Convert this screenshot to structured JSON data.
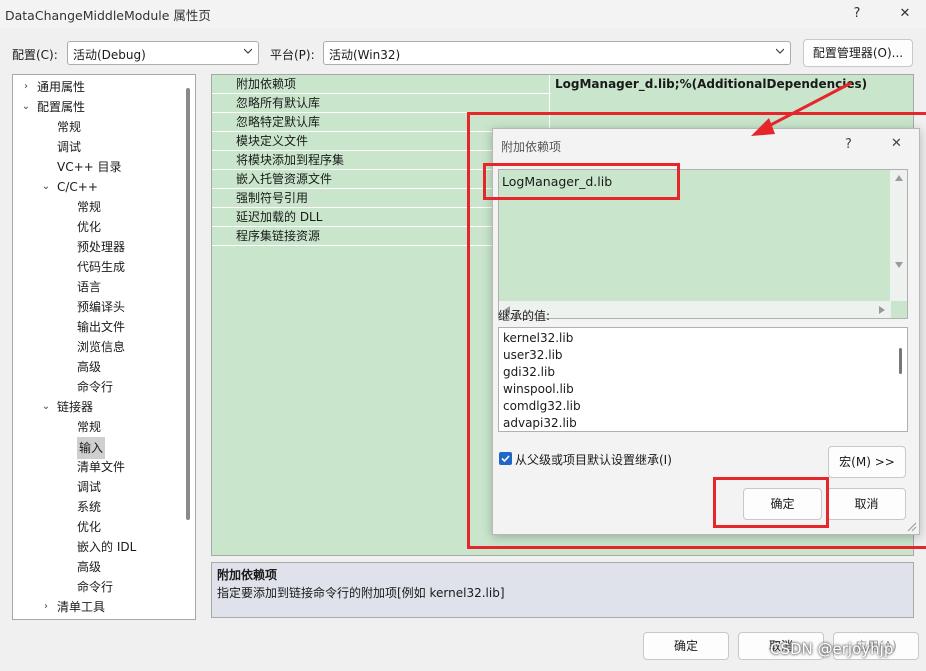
{
  "window": {
    "title": "DataChangeMiddleModule 属性页",
    "help_label": "?",
    "close_label": "✕"
  },
  "toolbar": {
    "config_label": "配置(C):",
    "config_value": "活动(Debug)",
    "platform_label": "平台(P):",
    "platform_value": "活动(Win32)",
    "config_manager_label": "配置管理器(O)..."
  },
  "tree": {
    "items": [
      {
        "label": "通用属性",
        "arrow": "›"
      },
      {
        "label": "配置属性",
        "arrow": "⌄"
      },
      {
        "label": "常规"
      },
      {
        "label": "调试"
      },
      {
        "label": "VC++ 目录"
      },
      {
        "label": "C/C++",
        "arrow": "⌄"
      },
      {
        "label": "常规"
      },
      {
        "label": "优化"
      },
      {
        "label": "预处理器"
      },
      {
        "label": "代码生成"
      },
      {
        "label": "语言"
      },
      {
        "label": "预编译头"
      },
      {
        "label": "输出文件"
      },
      {
        "label": "浏览信息"
      },
      {
        "label": "高级"
      },
      {
        "label": "命令行"
      },
      {
        "label": "链接器",
        "arrow": "⌄"
      },
      {
        "label": "常规"
      },
      {
        "label": "输入",
        "selected": true
      },
      {
        "label": "清单文件"
      },
      {
        "label": "调试"
      },
      {
        "label": "系统"
      },
      {
        "label": "优化"
      },
      {
        "label": "嵌入的 IDL"
      },
      {
        "label": "高级"
      },
      {
        "label": "命令行"
      },
      {
        "label": "清单工具",
        "arrow": "›"
      }
    ]
  },
  "grid": {
    "rows": [
      {
        "name": "附加依赖项",
        "value": "LogManager_d.lib;%(AdditionalDependencies)"
      },
      {
        "name": "忽略所有默认库",
        "value": ""
      },
      {
        "name": "忽略特定默认库",
        "value": ""
      },
      {
        "name": "模块定义文件",
        "value": ""
      },
      {
        "name": "将模块添加到程序集",
        "value": ""
      },
      {
        "name": "嵌入托管资源文件",
        "value": ""
      },
      {
        "name": "强制符号引用",
        "value": ""
      },
      {
        "name": "延迟加载的 DLL",
        "value": ""
      },
      {
        "name": "程序集链接资源",
        "value": ""
      }
    ]
  },
  "description": {
    "title": "附加依赖项",
    "text": "指定要添加到链接命令行的附加项[例如 kernel32.lib]"
  },
  "dialog": {
    "title": "附加依赖项",
    "help_label": "?",
    "close_label": "✕",
    "editor_text": "LogManager_d.lib",
    "inherited_label": "继承的值:",
    "inherited": [
      "kernel32.lib",
      "user32.lib",
      "gdi32.lib",
      "winspool.lib",
      "comdlg32.lib",
      "advapi32.lib"
    ],
    "inherit_checkbox_label": "从父级或项目默认设置继承(I)",
    "inherit_checked": true,
    "macro_button": "宏(M) >>",
    "ok_button": "确定",
    "cancel_button": "取消"
  },
  "footer": {
    "ok_button": "确定",
    "cancel_button": "取消",
    "apply_button": "应用(A)"
  },
  "watermark": "CSDN @erjoyhjp",
  "colors": {
    "grid_bg": "#c9e6cc",
    "annotation_red": "#e5262b",
    "checkbox_blue": "#1e66c8"
  }
}
